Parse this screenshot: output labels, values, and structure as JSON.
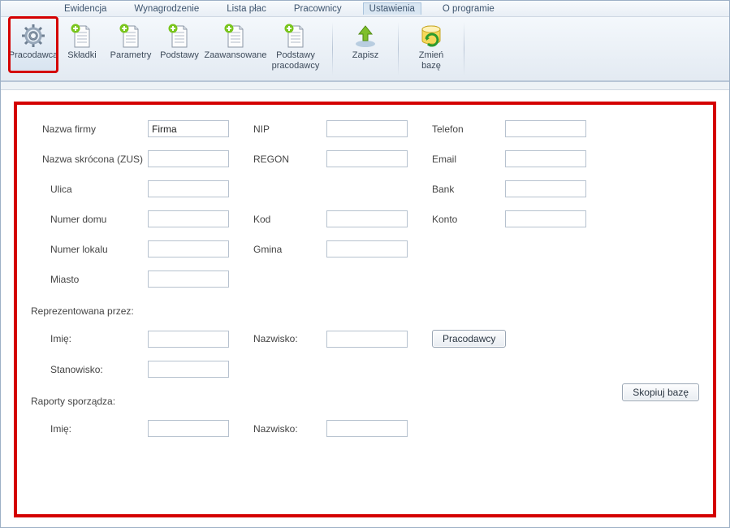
{
  "menubar": {
    "items": [
      {
        "label": "Ewidencja"
      },
      {
        "label": "Wynagrodzenie"
      },
      {
        "label": "Lista płac"
      },
      {
        "label": "Pracownicy"
      },
      {
        "label": "Ustawienia",
        "active": true
      },
      {
        "label": "O programie"
      }
    ]
  },
  "ribbon": {
    "group1": [
      {
        "label": "Pracodawca",
        "icon": "gear",
        "selected": true,
        "highlight": true
      },
      {
        "label": "Składki",
        "icon": "docplus"
      },
      {
        "label": "Parametry",
        "icon": "docplus"
      },
      {
        "label": "Podstawy",
        "icon": "docplus"
      },
      {
        "label": "Zaawansowane",
        "icon": "docplus"
      },
      {
        "label": "Podstawy\npracodawcy",
        "icon": "docplus"
      }
    ],
    "group2": [
      {
        "label": "Zapisz",
        "icon": "save"
      }
    ],
    "group3": [
      {
        "label": "Zmień\nbazę",
        "icon": "dbrefresh"
      }
    ]
  },
  "form": {
    "labels": {
      "nazwa_firmy": "Nazwa firmy",
      "nip": "NIP",
      "telefon": "Telefon",
      "nazwa_skrocona": "Nazwa skrócona (ZUS)",
      "regon": "REGON",
      "email": "Email",
      "ulica": "Ulica",
      "bank": "Bank",
      "numer_domu": "Numer domu",
      "kod": "Kod",
      "konto": "Konto",
      "numer_lokalu": "Numer lokalu",
      "gmina": "Gmina",
      "miasto": "Miasto",
      "reprezentowana": "Reprezentowana przez:",
      "imie": "Imię:",
      "nazwisko": "Nazwisko:",
      "stanowisko": "Stanowisko:",
      "raporty": "Raporty sporządza:"
    },
    "values": {
      "nazwa_firmy": "Firma",
      "nip": "",
      "telefon": "",
      "nazwa_skrocona": "",
      "regon": "",
      "email": "",
      "ulica": "",
      "bank": "",
      "numer_domu": "",
      "kod": "",
      "konto": "",
      "numer_lokalu": "",
      "gmina": "",
      "miasto": "",
      "rep_imie": "",
      "rep_nazwisko": "",
      "rep_stanowisko": "",
      "rap_imie": "",
      "rap_nazwisko": ""
    },
    "buttons": {
      "pracodawcy": "Pracodawcy",
      "skopiuj_baze": "Skopiuj bazę"
    }
  }
}
